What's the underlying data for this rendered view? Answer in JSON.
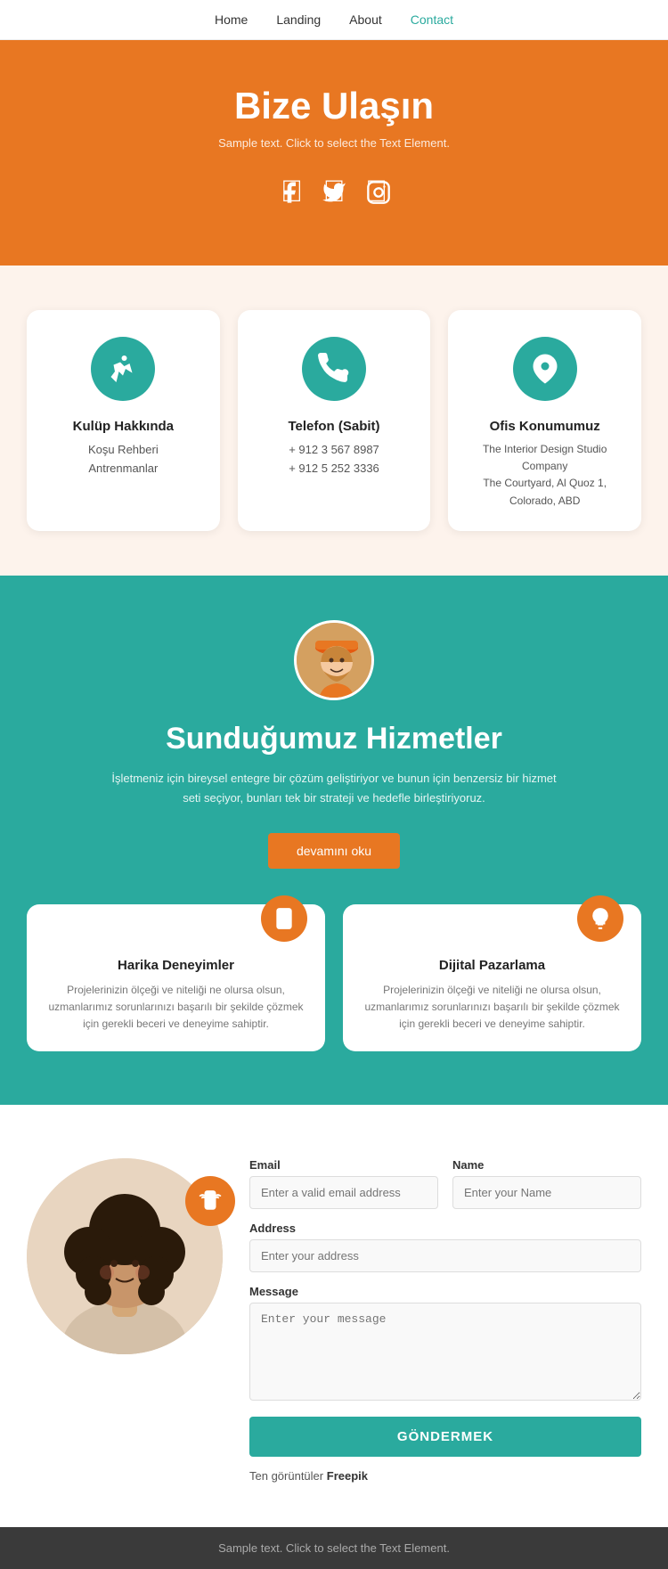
{
  "nav": {
    "items": [
      {
        "label": "Home",
        "active": false
      },
      {
        "label": "Landing",
        "active": false
      },
      {
        "label": "About",
        "active": false
      },
      {
        "label": "Contact",
        "active": true
      }
    ]
  },
  "hero": {
    "title": "Bize Ulaşın",
    "subtitle": "Sample text. Click to select the Text Element.",
    "icons": [
      "facebook",
      "twitter",
      "instagram"
    ]
  },
  "contact_cards": [
    {
      "icon": "runner",
      "title": "Kulüp Hakkında",
      "lines": [
        "Koşu Rehberi",
        "Antrenmanlar"
      ]
    },
    {
      "icon": "phone",
      "title": "Telefon (Sabit)",
      "lines": [
        "+ 912 3 567 8987",
        "+ 912 5 252 3336"
      ]
    },
    {
      "icon": "location",
      "title": "Ofis Konumumuz",
      "lines": [
        "The Interior Design Studio Company",
        "The Courtyard, Al Quoz 1, Colorado, ABD"
      ]
    }
  ],
  "services": {
    "section_title": "Sunduğumuz Hizmetler",
    "subtitle": "İşletmeniz için bireysel entegre bir çözüm geliştiriyor ve bunun için benzersiz bir hizmet seti seçiyor, bunları tek bir strateji ve hedefle birleştiriyoruz.",
    "read_more_btn": "devamını oku",
    "cards": [
      {
        "icon": "mobile",
        "title": "Harika Deneyimler",
        "description": "Projelerinizin ölçeği ve niteliği ne olursa olsun, uzmanlarımız sorunlarınızı başarılı bir şekilde çözmek için gerekli beceri ve deneyime sahiptir."
      },
      {
        "icon": "bulb",
        "title": "Dijital Pazarlama",
        "description": "Projelerinizin ölçeği ve niteliği ne olursa olsun, uzmanlarımız sorunlarınızı başarılı bir şekilde çözmek için gerekli beceri ve deneyime sahiptir."
      }
    ]
  },
  "contact_form": {
    "email_label": "Email",
    "email_placeholder": "Enter a valid email address",
    "name_label": "Name",
    "name_placeholder": "Enter your Name",
    "address_label": "Address",
    "address_placeholder": "Enter your address",
    "message_label": "Message",
    "message_placeholder": "Enter your message",
    "submit_btn": "GÖNDERMEK",
    "credit_text": "Ten görüntüler",
    "credit_link": "Freepik"
  },
  "footer": {
    "text": "Sample text. Click to select the Text Element."
  }
}
